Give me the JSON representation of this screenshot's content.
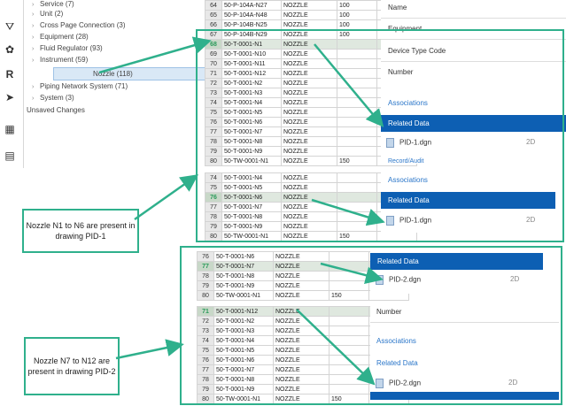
{
  "tree": {
    "items": [
      {
        "label": "Service (7)",
        "chev": "›"
      },
      {
        "label": "Unit (2)",
        "chev": "›"
      },
      {
        "label": "Cross Page Connection (3)",
        "chev": "›"
      },
      {
        "label": "Equipment (28)",
        "chev": "›"
      },
      {
        "label": "Fluid Regulator (93)",
        "chev": "›"
      },
      {
        "label": "Instrument (59)",
        "chev": "›"
      },
      {
        "label": "Nozzle (118)",
        "chev": ""
      },
      {
        "label": "Piping Network System (71)",
        "chev": "›"
      },
      {
        "label": "System (3)",
        "chev": "›"
      },
      {
        "label": "Unsaved Changes",
        "chev": ""
      }
    ]
  },
  "toolbar": {
    "icons": [
      "filter-icon",
      "settings-icon",
      "r-icon",
      "arrow-icon",
      "grid-icon",
      "file-icon"
    ]
  },
  "grid_top": {
    "rows": [
      {
        "num": "64",
        "tag": "50-P-104A-N27",
        "type": "NOZZLE",
        "val": "100"
      },
      {
        "num": "65",
        "tag": "50-P-104A-N48",
        "type": "NOZZLE",
        "val": "100"
      },
      {
        "num": "66",
        "tag": "50-P-104B-N25",
        "type": "NOZZLE",
        "val": "100"
      },
      {
        "num": "67",
        "tag": "50-P-104B-N29",
        "type": "NOZZLE",
        "val": "100"
      },
      {
        "num": "68",
        "tag": "50-T-0001-N1",
        "type": "NOZZLE",
        "val": "",
        "hl": true
      },
      {
        "num": "69",
        "tag": "50-T-0001-N10",
        "type": "NOZZLE",
        "val": ""
      },
      {
        "num": "70",
        "tag": "50-T-0001-N11",
        "type": "NOZZLE",
        "val": ""
      },
      {
        "num": "71",
        "tag": "50-T-0001-N12",
        "type": "NOZZLE",
        "val": ""
      },
      {
        "num": "72",
        "tag": "50-T-0001-N2",
        "type": "NOZZLE",
        "val": ""
      },
      {
        "num": "73",
        "tag": "50-T-0001-N3",
        "type": "NOZZLE",
        "val": ""
      },
      {
        "num": "74",
        "tag": "50-T-0001-N4",
        "type": "NOZZLE",
        "val": ""
      },
      {
        "num": "75",
        "tag": "50-T-0001-N5",
        "type": "NOZZLE",
        "val": ""
      },
      {
        "num": "76",
        "tag": "50-T-0001-N6",
        "type": "NOZZLE",
        "val": ""
      },
      {
        "num": "77",
        "tag": "50-T-0001-N7",
        "type": "NOZZLE",
        "val": ""
      },
      {
        "num": "78",
        "tag": "50-T-0001-N8",
        "type": "NOZZLE",
        "val": ""
      },
      {
        "num": "79",
        "tag": "50-T-0001-N9",
        "type": "NOZZLE",
        "val": ""
      },
      {
        "num": "80",
        "tag": "50-TW-0001-N1",
        "type": "NOZZLE",
        "val": "150"
      }
    ]
  },
  "grid_mid": {
    "rows": [
      {
        "num": "74",
        "tag": "50-T-0001-N4",
        "type": "NOZZLE",
        "val": ""
      },
      {
        "num": "75",
        "tag": "50-T-0001-N5",
        "type": "NOZZLE",
        "val": ""
      },
      {
        "num": "76",
        "tag": "50-T-0001-N6",
        "type": "NOZZLE",
        "val": "",
        "hl": true
      },
      {
        "num": "77",
        "tag": "50-T-0001-N7",
        "type": "NOZZLE",
        "val": ""
      },
      {
        "num": "78",
        "tag": "50-T-0001-N8",
        "type": "NOZZLE",
        "val": ""
      },
      {
        "num": "79",
        "tag": "50-T-0001-N9",
        "type": "NOZZLE",
        "val": ""
      },
      {
        "num": "80",
        "tag": "50-TW-0001-N1",
        "type": "NOZZLE",
        "val": "150"
      }
    ]
  },
  "grid_b1": {
    "rows": [
      {
        "num": "76",
        "tag": "50-T-0001-N6",
        "type": "NOZZLE",
        "val": ""
      },
      {
        "num": "77",
        "tag": "50-T-0001-N7",
        "type": "NOZZLE",
        "val": "",
        "hl": true
      },
      {
        "num": "78",
        "tag": "50-T-0001-N8",
        "type": "NOZZLE",
        "val": ""
      },
      {
        "num": "79",
        "tag": "50-T-0001-N9",
        "type": "NOZZLE",
        "val": ""
      },
      {
        "num": "80",
        "tag": "50-TW-0001-N1",
        "type": "NOZZLE",
        "val": "150"
      }
    ]
  },
  "grid_b2": {
    "rows": [
      {
        "num": "71",
        "tag": "50-T-0001-N12",
        "type": "NOZZLE",
        "val": "",
        "hl": true
      },
      {
        "num": "72",
        "tag": "50-T-0001-N2",
        "type": "NOZZLE",
        "val": ""
      },
      {
        "num": "73",
        "tag": "50-T-0001-N3",
        "type": "NOZZLE",
        "val": ""
      },
      {
        "num": "74",
        "tag": "50-T-0001-N4",
        "type": "NOZZLE",
        "val": ""
      },
      {
        "num": "75",
        "tag": "50-T-0001-N5",
        "type": "NOZZLE",
        "val": ""
      },
      {
        "num": "76",
        "tag": "50-T-0001-N6",
        "type": "NOZZLE",
        "val": ""
      },
      {
        "num": "77",
        "tag": "50-T-0001-N7",
        "type": "NOZZLE",
        "val": ""
      },
      {
        "num": "78",
        "tag": "50-T-0001-N8",
        "type": "NOZZLE",
        "val": ""
      },
      {
        "num": "79",
        "tag": "50-T-0001-N9",
        "type": "NOZZLE",
        "val": ""
      },
      {
        "num": "80",
        "tag": "50-TW-0001-N1",
        "type": "NOZZLE",
        "val": "150"
      }
    ]
  },
  "panel_top": {
    "name": "Name",
    "equipment": "Equipment",
    "device_type_code": "Device Type Code",
    "number": "Number",
    "associations": "Associations",
    "related_data": "Related Data",
    "doc_name": "PID-1.dgn",
    "doc_type": "2D",
    "record_audit": "Record/Audit"
  },
  "panel_mid": {
    "associations": "Associations",
    "related_data": "Related Data",
    "doc_name": "PID-1.dgn",
    "doc_type": "2D"
  },
  "panel_b1": {
    "related_data": "Related Data",
    "doc_name": "PID-2.dgn",
    "doc_type": "2D"
  },
  "panel_b2": {
    "number": "Number",
    "associations": "Associations",
    "related_data": "Related Data",
    "doc_name": "PID-2.dgn",
    "doc_type": "2D"
  },
  "callouts": {
    "c1": "Nozzle N1 to N6 are present in drawing PID-1",
    "c2": "Nozzle N7 to N12 are present in drawing PID-2"
  },
  "colors": {
    "accent": "#2fb08c",
    "bar": "#0d5fb3",
    "link": "#2a76c9"
  }
}
